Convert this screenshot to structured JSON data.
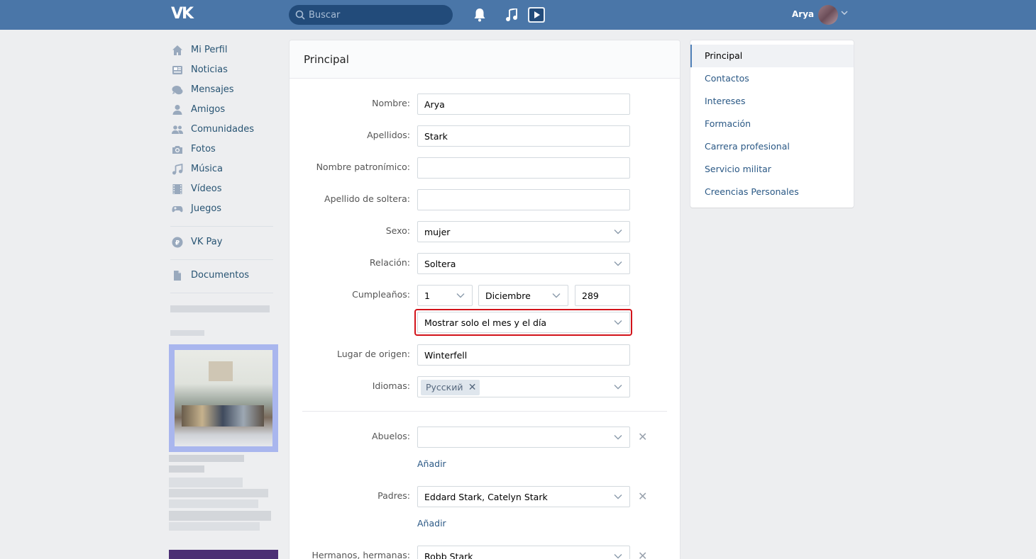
{
  "header": {
    "logo": "VK",
    "search_placeholder": "Buscar",
    "user_name": "Arya",
    "icons": [
      "bell-icon",
      "music-icon",
      "video-play-icon"
    ]
  },
  "leftnav": {
    "items": [
      {
        "label": "Mi Perfil",
        "icon": "home-icon"
      },
      {
        "label": "Noticias",
        "icon": "news-icon"
      },
      {
        "label": "Mensajes",
        "icon": "messages-icon"
      },
      {
        "label": "Amigos",
        "icon": "friend-icon"
      },
      {
        "label": "Comunidades",
        "icon": "groups-icon"
      },
      {
        "label": "Fotos",
        "icon": "camera-icon"
      },
      {
        "label": "Música",
        "icon": "music-icon"
      },
      {
        "label": "Vídeos",
        "icon": "film-icon"
      },
      {
        "label": "Juegos",
        "icon": "gamepad-icon"
      }
    ],
    "vkpay": {
      "label": "VK Pay",
      "icon": "vkpay-icon"
    },
    "docs": {
      "label": "Documentos",
      "icon": "document-icon"
    }
  },
  "main": {
    "title": "Principal",
    "fields": {
      "nombre": {
        "label": "Nombre:",
        "value": "Arya"
      },
      "apellidos": {
        "label": "Apellidos:",
        "value": "Stark"
      },
      "patronimico": {
        "label": "Nombre patronímico:",
        "value": ""
      },
      "soltera": {
        "label": "Apellido de soltera:",
        "value": ""
      },
      "sexo": {
        "label": "Sexo:",
        "value": "mujer"
      },
      "relacion": {
        "label": "Relación:",
        "value": "Soltera"
      },
      "cumple": {
        "label": "Cumpleaños:",
        "day": "1",
        "month": "Diciembre",
        "year": "289",
        "visibility": "Mostrar solo el mes y el día"
      },
      "origen": {
        "label": "Lugar de origen:",
        "value": "Winterfell"
      },
      "idiomas": {
        "label": "Idiomas:",
        "tag": "Русский"
      },
      "abuelos": {
        "label": "Abuelos:",
        "value": "",
        "add": "Añadir"
      },
      "padres": {
        "label": "Padres:",
        "value": "Eddard Stark, Catelyn Stark",
        "add": "Añadir"
      },
      "hermanos": {
        "label": "Hermanos, hermanas:",
        "value": "Robb Stark"
      }
    }
  },
  "rightmenu": {
    "items": [
      "Principal",
      "Contactos",
      "Intereses",
      "Formación",
      "Carrera profesional",
      "Servicio militar",
      "Creencias Personales"
    ]
  },
  "colors": {
    "header": "#4a76a8",
    "highlight": "#d2131a",
    "link": "#2a5885"
  }
}
